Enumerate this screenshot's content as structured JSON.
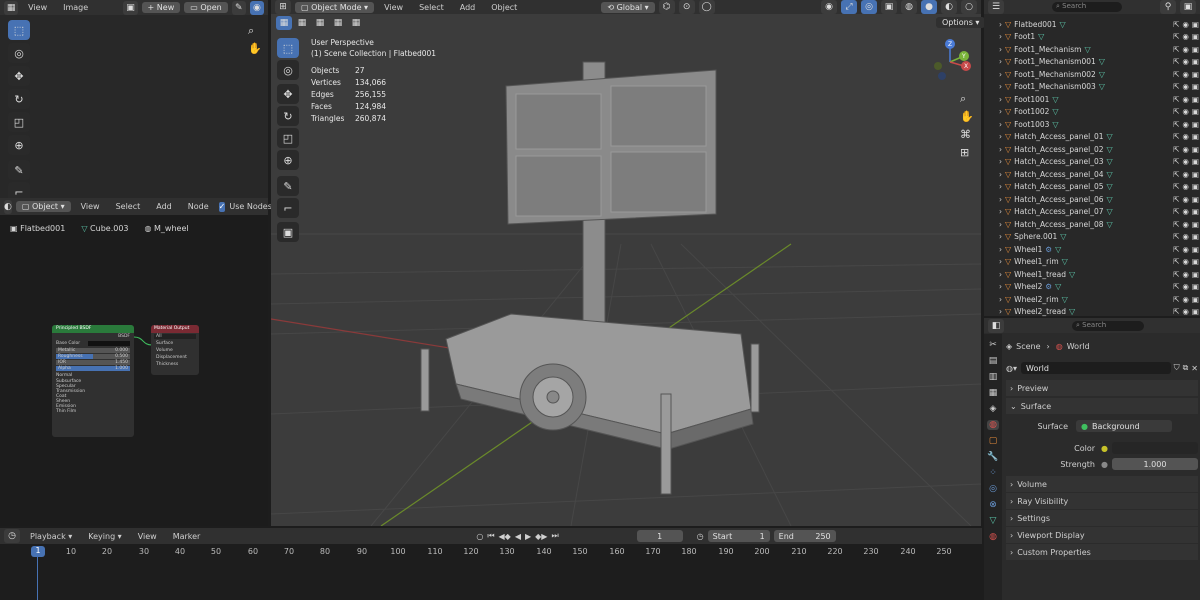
{
  "image_editor": {
    "menu": [
      "View",
      "Image"
    ],
    "new_label": "New",
    "open_label": "Open"
  },
  "node_editor": {
    "mode": "Object",
    "menu": [
      "View",
      "Select",
      "Add",
      "Node"
    ],
    "use_nodes_label": "Use Nodes",
    "breadcrumb": [
      "Flatbed001",
      "Cube.003",
      "M_wheel"
    ],
    "principled": {
      "title": "Principled BSDF",
      "out": "BSDF",
      "rows": [
        [
          "Base Color",
          ""
        ],
        [
          "Metallic",
          "0.000"
        ],
        [
          "Roughness",
          "0.500"
        ],
        [
          "IOR",
          "1.450"
        ],
        [
          "Alpha",
          "1.000"
        ]
      ],
      "sections": [
        "Normal",
        "Subsurface",
        "Specular",
        "Transmission",
        "Coat",
        "Sheen",
        "Emission",
        "Thin Film"
      ]
    },
    "output": {
      "title": "Material Output",
      "target": "All",
      "inputs": [
        "Surface",
        "Volume",
        "Displacement",
        "Thickness"
      ]
    }
  },
  "viewport": {
    "mode": "Object Mode",
    "menu": [
      "View",
      "Select",
      "Add",
      "Object"
    ],
    "transform": "Global",
    "options_label": "Options",
    "title": "User Perspective",
    "collection": "(1) Scene Collection | Flatbed001",
    "stats": [
      [
        "Objects",
        "27"
      ],
      [
        "Vertices",
        "134,066"
      ],
      [
        "Edges",
        "256,155"
      ],
      [
        "Faces",
        "124,984"
      ],
      [
        "Triangles",
        "260,874"
      ]
    ],
    "gizmo": {
      "z": "Z",
      "y": "Y",
      "x": "X"
    }
  },
  "outliner": {
    "search_placeholder": "Search",
    "items": [
      "Flatbed001",
      "Foot1",
      "Foot1_Mechanism",
      "Foot1_Mechanism001",
      "Foot1_Mechanism002",
      "Foot1_Mechanism003",
      "Foot1001",
      "Foot1002",
      "Foot1003",
      "Hatch_Access_panel_01",
      "Hatch_Access_panel_02",
      "Hatch_Access_panel_03",
      "Hatch_Access_panel_04",
      "Hatch_Access_panel_05",
      "Hatch_Access_panel_06",
      "Hatch_Access_panel_07",
      "Hatch_Access_panel_08",
      "Sphere.001",
      "Wheel1",
      "Wheel1_rim",
      "Wheel1_tread",
      "Wheel2",
      "Wheel2_rim",
      "Wheel2_tread"
    ]
  },
  "properties": {
    "search_placeholder": "Search",
    "breadcrumb_scene": "Scene",
    "breadcrumb_world": "World",
    "world_name": "World",
    "sections": [
      "Preview",
      "Surface",
      "Volume",
      "Ray Visibility",
      "Settings",
      "Viewport Display",
      "Custom Properties"
    ],
    "surface_label": "Surface",
    "surface_value": "Background",
    "color_label": "Color",
    "strength_label": "Strength",
    "strength_value": "1.000"
  },
  "timeline": {
    "menu": [
      "Playback",
      "Keying",
      "View",
      "Marker"
    ],
    "current_frame": "1",
    "start_label": "Start",
    "start_value": "1",
    "end_label": "End",
    "end_value": "250",
    "ticks": [
      "1",
      "10",
      "20",
      "30",
      "40",
      "50",
      "60",
      "70",
      "80",
      "90",
      "100",
      "110",
      "120",
      "130",
      "140",
      "150",
      "160",
      "170",
      "180",
      "190",
      "200",
      "210",
      "220",
      "230",
      "240",
      "250"
    ]
  }
}
